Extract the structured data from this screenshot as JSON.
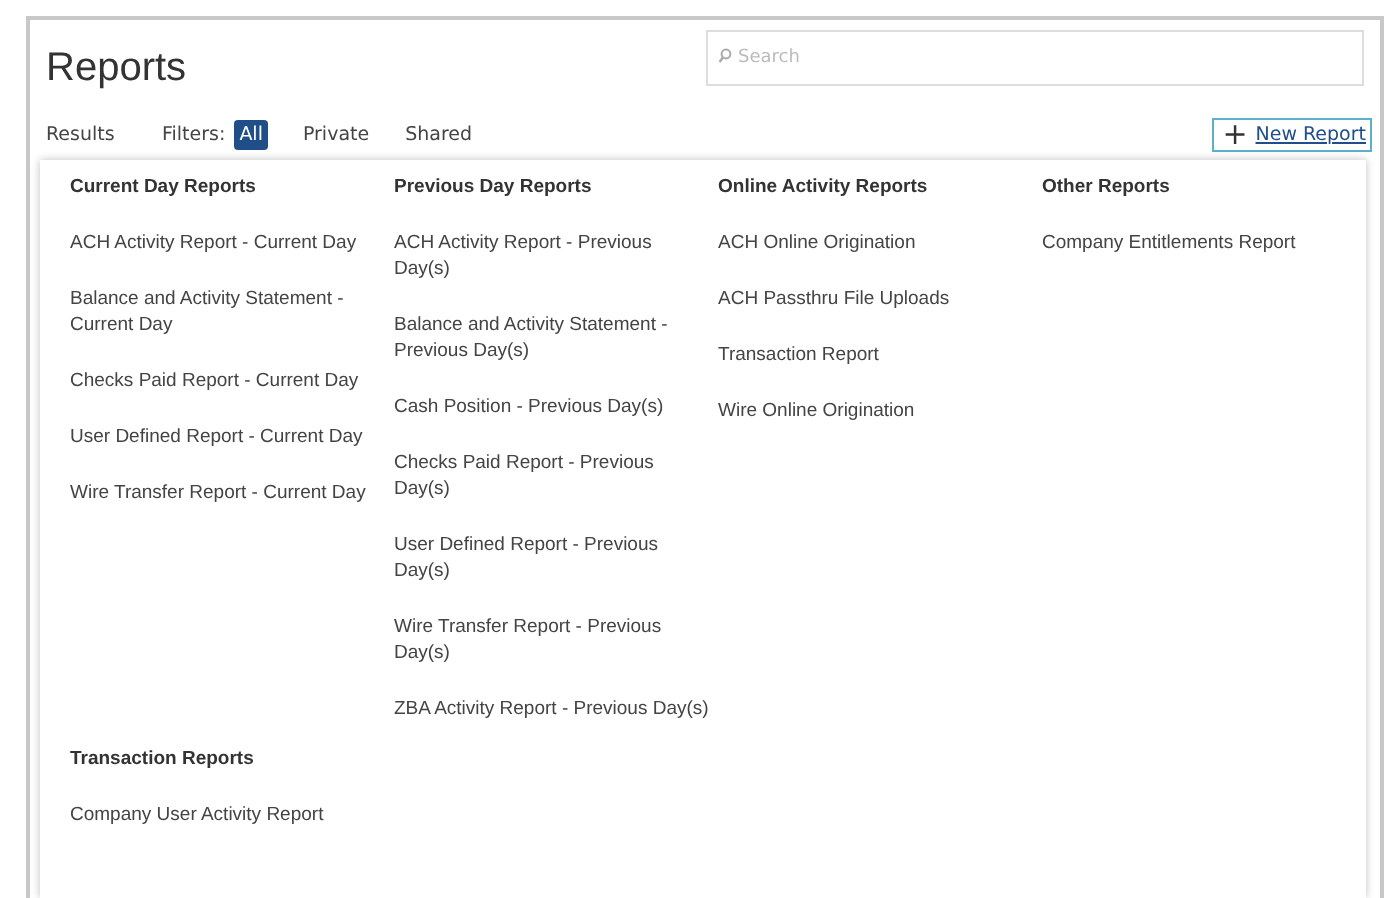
{
  "page": {
    "title": "Reports"
  },
  "search": {
    "placeholder": "Search"
  },
  "toolbar": {
    "results_label": "Results",
    "filters_label": "Filters:",
    "filters": [
      {
        "label": "All",
        "selected": true
      },
      {
        "label": "Private",
        "selected": false
      },
      {
        "label": "Shared",
        "selected": false
      }
    ],
    "new_button": {
      "icon": "+",
      "label": "New Report"
    }
  },
  "menu": {
    "groups": [
      {
        "heading": "Current Day Reports",
        "items": [
          "ACH Activity Report - Current Day",
          "Balance and Activity Statement - Current Day",
          "Checks Paid Report - Current Day",
          "User Defined Report - Current Day",
          "Wire Transfer Report - Current Day"
        ]
      },
      {
        "heading": "Previous Day Reports",
        "items": [
          "ACH Activity Report - Previous Day(s)",
          "Balance and Activity Statement - Previous Day(s)",
          "Cash Position - Previous Day(s)",
          "Checks Paid Report - Previous Day(s)",
          "User Defined Report - Previous Day(s)",
          "Wire Transfer Report - Previous Day(s)",
          "ZBA Activity Report - Previous Day(s)"
        ]
      },
      {
        "heading": "Online Activity Reports",
        "items": [
          "ACH Online Origination",
          "ACH Passthru File Uploads",
          "Transaction Report",
          "Wire Online Origination"
        ]
      },
      {
        "heading": "Other Reports",
        "items": [
          "Company Entitlements Report"
        ]
      },
      {
        "heading": "Transaction Reports",
        "items": [
          "Company User Activity Report"
        ]
      }
    ]
  }
}
